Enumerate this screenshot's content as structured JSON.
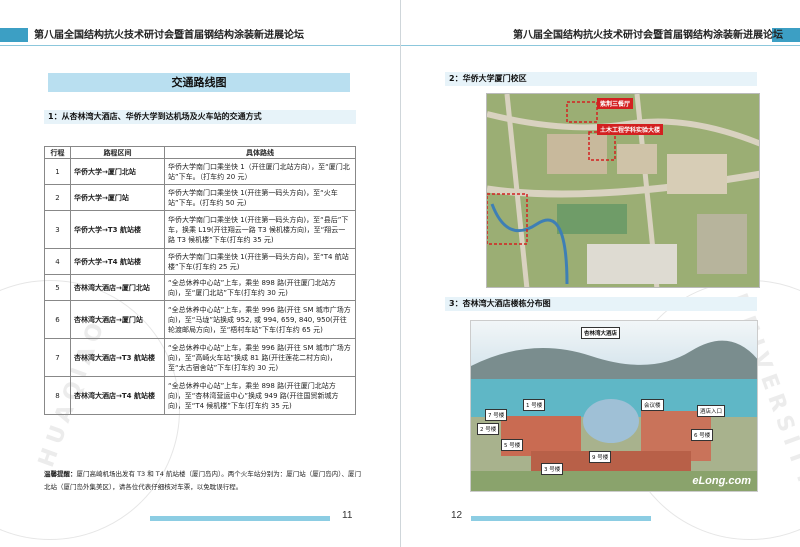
{
  "header": {
    "title": "第八届全国结构抗火技术研讨会暨首届钢结构涂装新进展论坛"
  },
  "left": {
    "title": "交通路线图",
    "section1": "1：从杏林湾大酒店、华侨大学到达机场及火车站的交通方式",
    "table": {
      "headers": [
        "行程",
        "路程区间",
        "具体路线"
      ],
      "rows": [
        {
          "no": "1",
          "route": "华侨大学→厦门北站",
          "detail": "华侨大学南门口乘坐快 1（开往厦门北站方向），至“厦门北站”下车。（打车约 20 元）"
        },
        {
          "no": "2",
          "route": "华侨大学→厦门站",
          "detail": "华侨大学南门口乘坐快 1(开往第一码头方向)，至“火车站”下车。(打车约 50 元)"
        },
        {
          "no": "3",
          "route": "华侨大学→T3 航站楼",
          "detail": "华侨大学南门口乘坐快 1(开往第一码头方向)，至“县后”下车，换乘 L19(开往翔云一路 T3 候机楼方向)，至“翔云一路 T3 候机楼”下车(打车约 35 元)"
        },
        {
          "no": "4",
          "route": "华侨大学→T4 航站楼",
          "detail": "华侨大学南门口乘坐快 1(开往第一码头方向)，至“T4 航站楼”下车(打车约 25 元)"
        },
        {
          "no": "5",
          "route": "杏林湾大酒店→厦门北站",
          "detail": "“全总休养中心站”上车，乘坐 898 路(开往厦门北站方向)，至“厦门北站”下车(打车约 30 元)"
        },
        {
          "no": "6",
          "route": "杏林湾大酒店→厦门站",
          "detail": "“全总休养中心站”上车，乘坐 996 路(开往 SM 城市广场方向)，至“马垅”站换成 952, 或 994, 659, 840, 950(开往轮渡邮局方向)，至“梧村车站”下车(打车约 65 元)"
        },
        {
          "no": "7",
          "route": "杏林湾大酒店→T3 航站楼",
          "detail": "“全总休养中心站”上车，乘坐 996 路(开往 SM 城市广场方向)，至“高崎火车站”换成 81 路(开往莲花二村方向)，至“太古宿舍站”下车(打车约 30 元)"
        },
        {
          "no": "8",
          "route": "杏林湾大酒店→T4 航站楼",
          "detail": "“全总休养中心站”上车，乘坐 898 路(开往厦门北站方向)，至“杏林湾营运中心”换成 949 路(开往国贸新城方向)，至“T4 候机楼”下车(打车约 35 元)"
        }
      ]
    },
    "note_label": "温馨提醒：",
    "note_text": "厦门高崎机场出发有 T3 和 T4 航站楼（厦门岛内）。两个火车站分别为：厦门站（厦门岛内）、厦门北站（厦门岛外集美区），请各位代表仔细核对车票，以免耽误行程。",
    "page_number": "11",
    "seal_text": "HUAQIAO"
  },
  "right": {
    "section2": "2：华侨大学厦门校区",
    "section3": "3：杏林湾大酒店楼栋分布图",
    "map_labels": [
      "紫荆三餐厅",
      "土木工程学科实验大楼"
    ],
    "hotel_title": "杏林湾大酒店",
    "building_labels": [
      "1 号楼",
      "2 号楼",
      "3 号楼",
      "5 号楼",
      "6 号楼",
      "7 号楼",
      "9 号楼",
      "会议楼",
      "酒店入口"
    ],
    "watermark": "eLong.com",
    "page_number": "12",
    "seal_text": "UNIVERSITY"
  }
}
